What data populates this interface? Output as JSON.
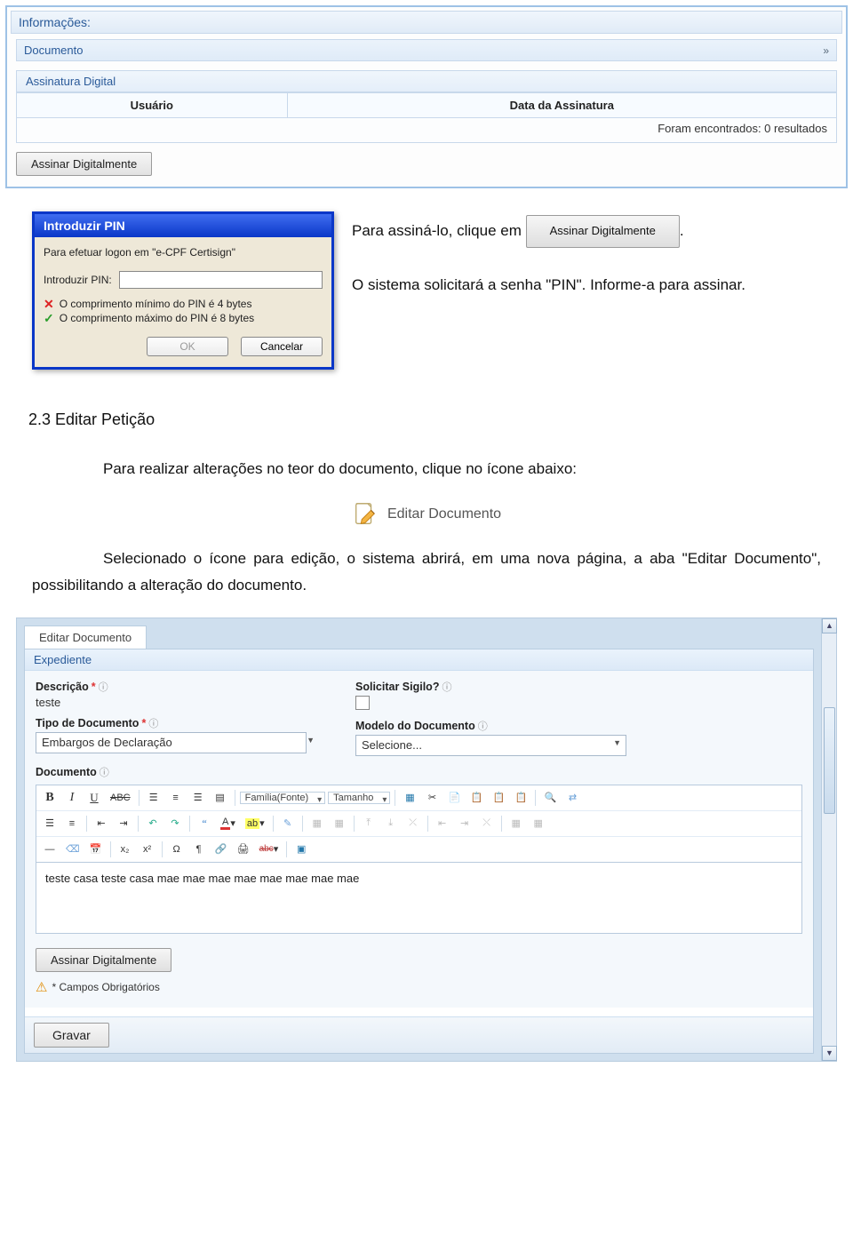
{
  "info_panel": {
    "title": "Informações:",
    "doc_label": "Documento",
    "expand": "»",
    "sig_title": "Assinatura Digital",
    "th_user": "Usuário",
    "th_date": "Data da Assinatura",
    "results": "Foram encontrados: 0 resultados",
    "sign_btn": "Assinar Digitalmente"
  },
  "pin_dialog": {
    "title": "Introduzir PIN",
    "line1": "Para efetuar logon em \"e-CPF Certisign\"",
    "field_label": "Introduzir PIN:",
    "rule_min": "O comprimento mínimo do PIN é 4 bytes",
    "rule_max": "O comprimento máximo do PIN é 8 bytes",
    "ok": "OK",
    "cancel": "Cancelar"
  },
  "inline": {
    "para1_a": "Para assiná-lo, clique em",
    "btn_inline": "Assinar Digitalmente",
    "para1_b": ".",
    "para2": "O sistema solicitará a senha \"PIN\". Informe-a para assinar."
  },
  "section": {
    "heading": "2.3 Editar Petição",
    "p1": "Para realizar alterações no teor do documento, clique no ícone abaixo:",
    "edit_btn": "Editar Documento",
    "p2": "Selecionado o ícone para edição, o sistema abrirá, em uma nova página, a aba \"Editar Documento\", possibilitando a alteração do documento."
  },
  "editor": {
    "tab": "Editar Documento",
    "panel_title": "Expediente",
    "lbl_desc": "Descrição",
    "val_desc": "teste",
    "lbl_sigilo": "Solicitar Sigilo?",
    "lbl_tipo": "Tipo de Documento",
    "val_tipo": "Embargos de Declaração",
    "lbl_modelo": "Modelo do Documento",
    "val_modelo": "Selecione...",
    "lbl_doc": "Documento",
    "font_family": "Família(Fonte)",
    "font_size": "Tamanho",
    "content": "teste casa teste casa mae mae mae mae mae mae mae mae",
    "sign_btn": "Assinar Digitalmente",
    "required_note": "* Campos Obrigatórios",
    "save": "Gravar",
    "ast": "*"
  }
}
